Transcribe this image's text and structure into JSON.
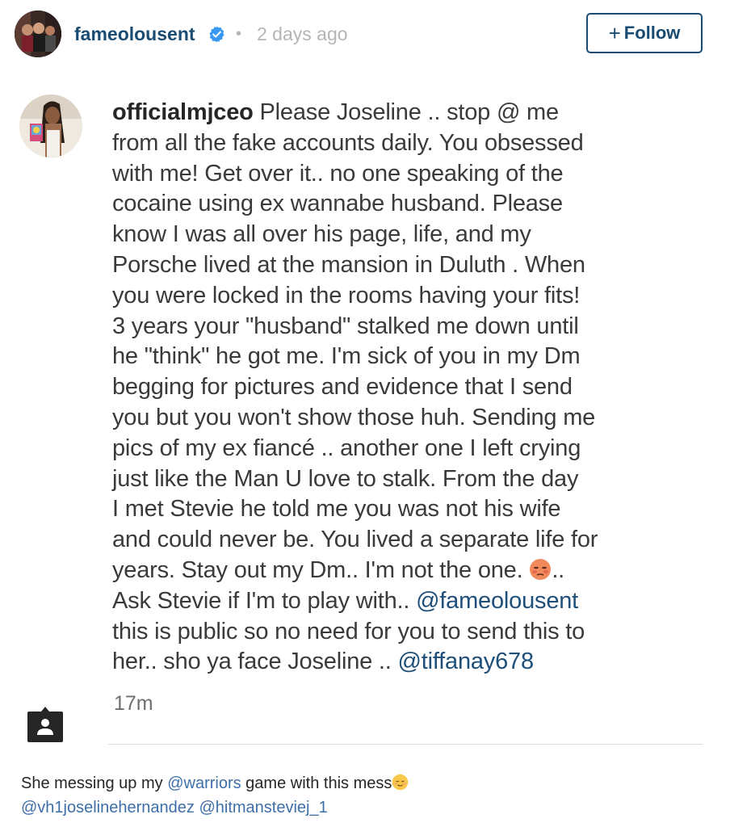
{
  "header": {
    "username": "fameolousent",
    "verified": true,
    "separator": "•",
    "timestamp": "2 days ago",
    "follow_plus": "+",
    "follow_label": "Follow",
    "icons": {
      "verified": "verified-badge-icon",
      "avatar": "profile-avatar"
    },
    "colors": {
      "username": "#1a4c73",
      "verified_badge": "#3897f0",
      "timestamp": "#b5b5b5",
      "follow_border": "#1a4c73"
    }
  },
  "comment": {
    "username": "officialmjceo",
    "lines": [
      " Please Joseline .. stop @ me",
      "from all the fake accounts daily. You obsessed",
      "with me! Get over it.. no one speaking of the",
      "cocaine using ex wannabe husband. Please",
      "know I was all over his page, life, and my",
      "Porsche lived at the mansion in Duluth . When",
      "you were locked in the rooms having your fits!",
      "3 years your \"husband\" stalked me down until",
      "he \"think\" he got me. I'm sick of you in my Dm",
      "begging for pictures and evidence that I send",
      "you but you won't show those huh. Sending me",
      "pics of my ex fiancé .. another one I left crying",
      "just like the Man U love to stalk. From the day",
      "I met Stevie he told me you was not his wife",
      "and could never be. You lived a separate life for",
      "years. Stay out my Dm.. I'm not the one. ",
      "Ask Stevie if I'm to play with.. ",
      "this is public so no need for you to send this to",
      "her.. sho ya face Joseline .. "
    ],
    "line16_tail": "..",
    "mention_1": "@fameolousent",
    "mention_2": "@tiffanay678",
    "time": "17m",
    "icons": {
      "emoji": "flushed-face-emoji-icon",
      "tag": "tagged-people-icon"
    }
  },
  "caption": {
    "text_1": "She messing up my ",
    "mention_warriors": "@warriors",
    "text_2": " game with this mess",
    "mention_joseline": "@vh1joselinehernandez",
    "text_3": " ",
    "mention_stevie": "@hitmansteviej_1",
    "icons": {
      "emoji": "relieved-face-emoji-icon"
    },
    "colors": {
      "mention": "#3e6fa8"
    }
  }
}
